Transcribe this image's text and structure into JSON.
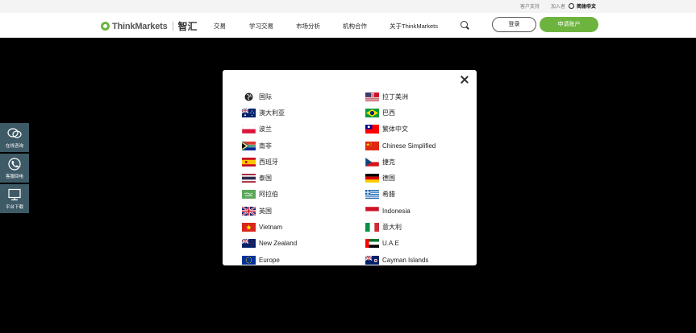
{
  "util_bar": {
    "links": [
      "客户支持",
      "加入者",
      "代理后台"
    ],
    "language": "简体中文"
  },
  "brand": {
    "name": "ThinkMarkets",
    "cn_name": "智汇"
  },
  "nav": {
    "items": [
      "交易",
      "学习交易",
      "市场分析",
      "机构合作",
      "关于ThinkMarkets"
    ],
    "login_label": "登录",
    "apply_label": "申请账户"
  },
  "side_toolbar": {
    "items": [
      "在线咨询",
      "客服回电",
      "平台下载"
    ]
  },
  "modal": {
    "left_regions": [
      {
        "label": "国际",
        "flag": "globe"
      },
      {
        "label": "澳大利亚",
        "flag": "australia"
      },
      {
        "label": "波兰",
        "flag": "poland"
      },
      {
        "label": "南非",
        "flag": "south-africa"
      },
      {
        "label": "西班牙",
        "flag": "spain"
      },
      {
        "label": "泰国",
        "flag": "thailand"
      },
      {
        "label": "阿拉伯",
        "flag": "arabia"
      },
      {
        "label": "英国",
        "flag": "uk"
      },
      {
        "label": "Vietnam",
        "flag": "vietnam"
      },
      {
        "label": "New Zealand",
        "flag": "new-zealand"
      },
      {
        "label": "Europe",
        "flag": "europe"
      }
    ],
    "right_regions": [
      {
        "label": "拉丁美洲",
        "flag": "latam"
      },
      {
        "label": "巴西",
        "flag": "brazil"
      },
      {
        "label": "繁体中文",
        "flag": "taiwan"
      },
      {
        "label": "Chinese Simplified",
        "flag": "china"
      },
      {
        "label": "捷克",
        "flag": "czech"
      },
      {
        "label": "德国",
        "flag": "germany"
      },
      {
        "label": "希腊",
        "flag": "greece"
      },
      {
        "label": "Indonesia",
        "flag": "indonesia"
      },
      {
        "label": "意大利",
        "flag": "italy"
      },
      {
        "label": "U.A.E",
        "flag": "uae"
      },
      {
        "label": "Cayman Islands",
        "flag": "cayman"
      }
    ]
  },
  "colors": {
    "brand_green": "#6db43f",
    "side_toolbar": "#3d5a66"
  }
}
